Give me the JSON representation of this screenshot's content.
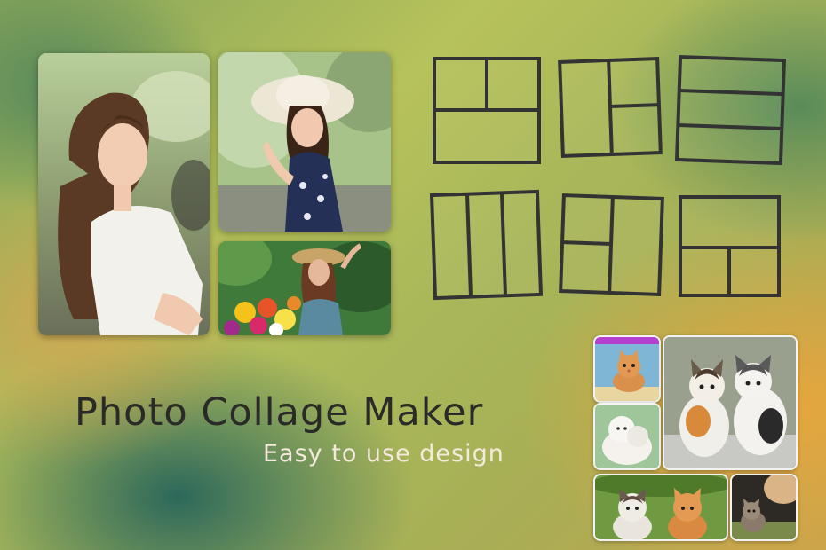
{
  "banner": {
    "title": "Photo Collage Maker",
    "subtitle": "Easy to use design"
  },
  "collage_photos": [
    {
      "subject": "woman in white lace dress portrait"
    },
    {
      "subject": "woman with white sun hat"
    },
    {
      "subject": "woman with straw hat holding flowers"
    }
  ],
  "layout_templates": [
    "two-top-one-bottom",
    "one-left-two-right",
    "three-rows",
    "three-columns",
    "two-left-one-right",
    "one-top-two-bottom"
  ],
  "kitten_collage": [
    {
      "subject": "orange kitten"
    },
    {
      "subject": "white kitten"
    },
    {
      "subject": "two calico kittens"
    },
    {
      "subject": "two kittens in grass"
    },
    {
      "subject": "kitten with dog"
    }
  ],
  "colors": {
    "template_stroke": "#333333",
    "title_text": "#2a2a28",
    "subtitle_text": "#f3eadc",
    "accent_bar": "#b53fd0"
  }
}
